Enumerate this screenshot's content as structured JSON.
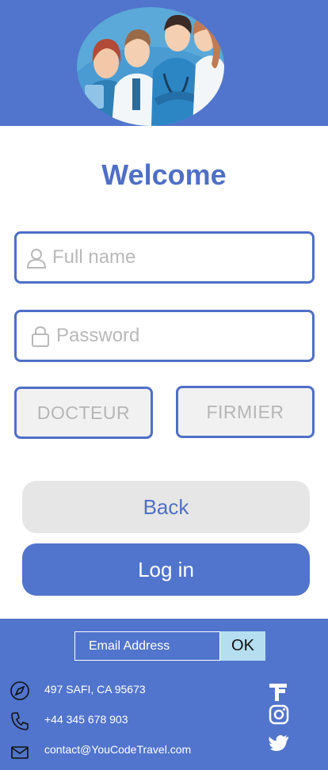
{
  "header": {
    "bg_color": "#5174cc",
    "illustration": "doctors-team-illustration"
  },
  "welcome": {
    "title": "Welcome"
  },
  "form": {
    "full_name": {
      "placeholder": "Full name",
      "icon": "user-icon"
    },
    "password": {
      "placeholder": "Password",
      "icon": "lock-icon"
    },
    "roles": [
      "DOCTEUR",
      "FIRMIER"
    ]
  },
  "actions": {
    "back_label": "Back",
    "login_label": "Log in"
  },
  "footer": {
    "email_placeholder": "Email Address",
    "ok_label": "OK",
    "address": "497  SAFI, CA 95673",
    "phone": "+44 345 678 903",
    "email": "contact@YouCodeTravel.com",
    "social": [
      "facebook-icon",
      "instagram-icon",
      "twitter-icon"
    ]
  },
  "colors": {
    "primary": "#5174cc",
    "text_primary": "#4f6fc6",
    "muted": "#b9b9b9",
    "ok_bg": "#b5dff1"
  }
}
